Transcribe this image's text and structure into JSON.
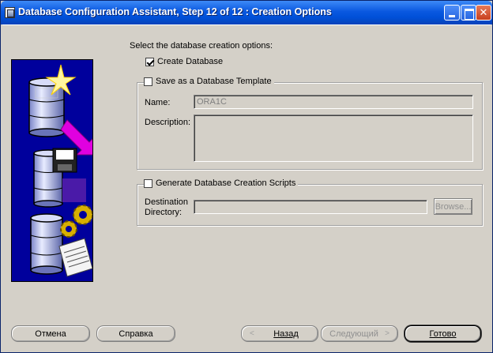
{
  "window": {
    "title": "Database Configuration Assistant, Step 12 of 12 : Creation Options"
  },
  "main": {
    "instruction": "Select the database creation options:",
    "create_database": {
      "label": "Create Database",
      "checked": true
    },
    "template_group": {
      "label": "Save as a Database Template",
      "checked": false,
      "name_label": "Name:",
      "name_value": "ORA1C",
      "description_label": "Description:",
      "description_value": ""
    },
    "scripts_group": {
      "label": "Generate Database Creation Scripts",
      "checked": false,
      "dest_label_1": "Destination",
      "dest_label_2": "Directory:",
      "dest_value": "",
      "browse_label": "Browse..."
    }
  },
  "footer": {
    "cancel_label": "Отмена",
    "help_label": "Справка",
    "back_label": "Назад",
    "back_arrow": "<",
    "next_label": "Следующий",
    "next_arrow": ">",
    "finish_label": "Готово"
  },
  "icons": [
    "app-icon",
    "minimize-icon",
    "maximize-icon",
    "close-icon",
    "database-wizard-illustration"
  ],
  "colors": {
    "title_bar": "#0a58e0",
    "dialog_bg": "#d4d0c8",
    "illustration_bg": "#00009c",
    "arrow": "#e000e0"
  }
}
